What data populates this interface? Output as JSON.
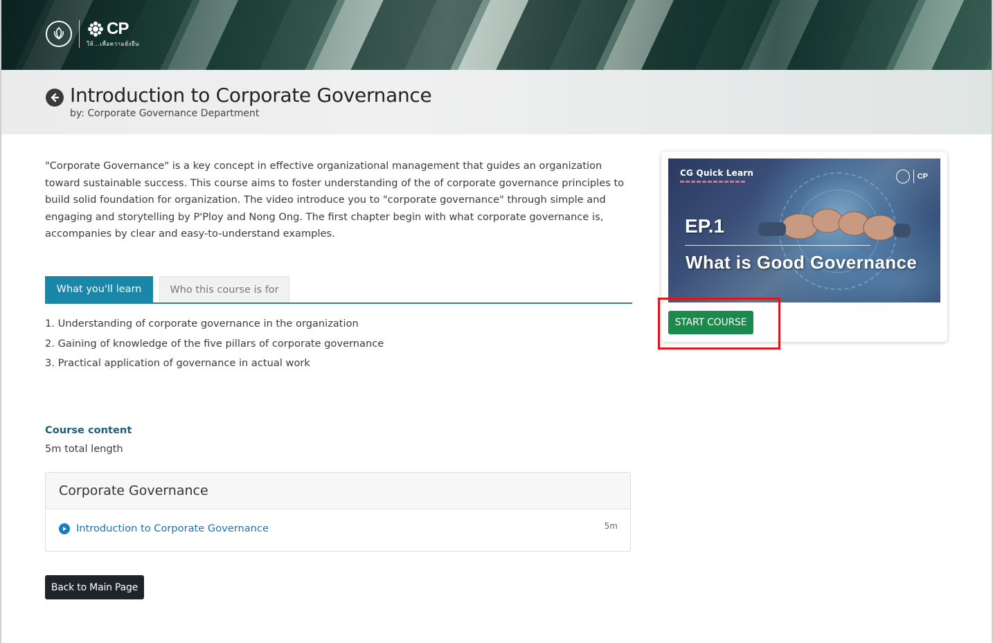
{
  "banner": {
    "logo_alt": "CP Sustainability logo",
    "logo_cp_text": "CP",
    "logo_tagline": "ให้...เพื่อความยั่งยืน"
  },
  "course": {
    "title": "Introduction to Corporate Governance",
    "by_label": "by:",
    "author": "Corporate Governance Department",
    "description": "\"Corporate Governance\" is a key concept in effective organizational management that guides an organization toward sustainable success. This course aims to foster understanding of the of corporate governance principles to build solid foundation for organization. The video introduce you to \"corporate governance\" through simple and engaging and storytelling by P'Ploy and Nong Ong. The first chapter begin with what corporate governance is, accompanies by clear and easy-to-understand examples."
  },
  "tabs": [
    {
      "label": "What you'll learn",
      "active": true
    },
    {
      "label": "Who this course is for",
      "active": false
    }
  ],
  "learn_items": [
    "1. Understanding of corporate governance in the organization",
    "2. Gaining of knowledge of the five pillars of corporate governance",
    "3. Practical application of governance in actual work"
  ],
  "content": {
    "heading": "Course content",
    "total_length": "5m total length",
    "sections": [
      {
        "title": "Corporate Governance",
        "lectures": [
          {
            "title": "Introduction to Corporate Governance",
            "duration": "5m"
          }
        ]
      }
    ]
  },
  "buttons": {
    "back": "Back to Main Page",
    "start": "START COURSE"
  },
  "thumbnail": {
    "series_label": "CG Quick Learn",
    "episode": "EP.1",
    "headline": "What is Good Governance",
    "logo_cp_text": "CP"
  },
  "colors": {
    "tab_active": "#1a86a8",
    "start_button": "#1c8a4c",
    "back_button": "#1f2428",
    "link": "#1a73ad",
    "highlight": "#e0161d"
  }
}
